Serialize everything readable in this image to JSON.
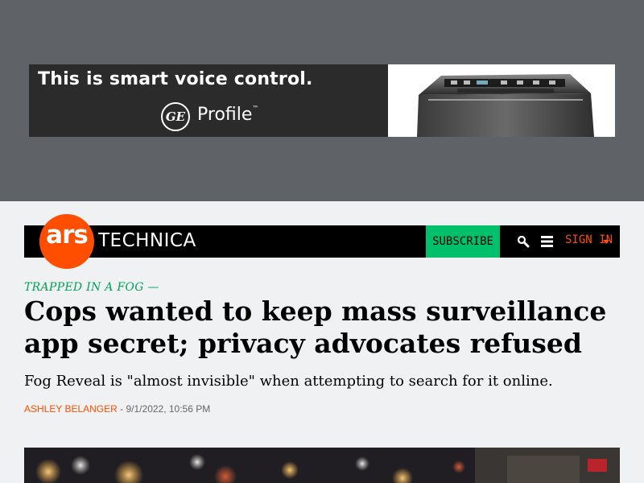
{
  "ad": {
    "headline": "This is smart voice control.",
    "brand_logo": "GE",
    "brand_name": "Profile",
    "trademark": "™",
    "product_icon": "washing-machine-icon"
  },
  "site": {
    "logo_ars": "ars",
    "logo_technica": "TECHNICA",
    "brand_color": "#ff4e00",
    "accent_color": "#00c06b"
  },
  "nav": {
    "subscribe_label": "SUBSCRIBE",
    "search_icon": "search-icon",
    "menu_icon": "menu-icon",
    "signin_label": "SIGN IN"
  },
  "article": {
    "kicker": "TRAPPED IN A FOG —",
    "title": "Cops wanted to keep mass surveillance app secret; privacy advocates refused",
    "dek": "Fog Reveal is \"almost invisible\" when attempting to search for it online.",
    "author": "Ashley Belanger",
    "separator": " - ",
    "datetime": "9/1/2022, 10:56 PM"
  }
}
